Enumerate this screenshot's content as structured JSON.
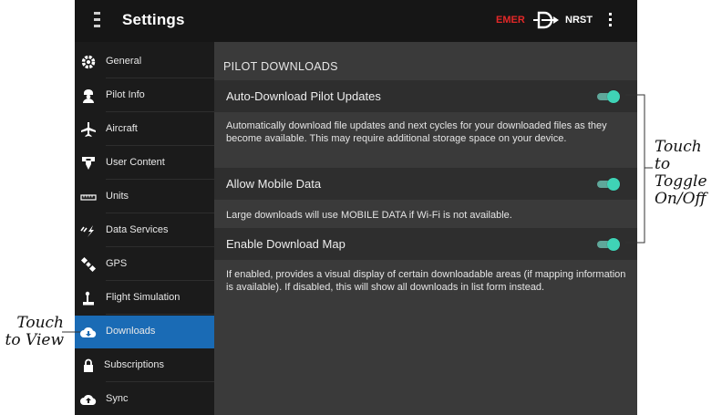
{
  "header": {
    "title": "Settings",
    "emer_label": "EMER",
    "nrst_label": "NRST",
    "menu_icon": "hamburger-menu-icon",
    "direct_to_icon": "direct-to-icon",
    "more_icon": "more-vert-icon"
  },
  "sidebar": {
    "items": [
      {
        "label": "General",
        "icon": "gear-icon"
      },
      {
        "label": "Pilot Info",
        "icon": "pilot-icon"
      },
      {
        "label": "Aircraft",
        "icon": "airplane-icon"
      },
      {
        "label": "User Content",
        "icon": "user-content-icon"
      },
      {
        "label": "Units",
        "icon": "ruler-icon"
      },
      {
        "label": "Data Services",
        "icon": "signal-icon"
      },
      {
        "label": "GPS",
        "icon": "satellite-icon"
      },
      {
        "label": "Flight Simulation",
        "icon": "joystick-icon"
      },
      {
        "label": "Downloads",
        "icon": "cloud-download-icon",
        "active": true
      },
      {
        "label": "Subscriptions",
        "icon": "lock-icon"
      },
      {
        "label": "Sync",
        "icon": "cloud-upload-icon"
      }
    ]
  },
  "main": {
    "section_title": "PILOT DOWNLOADS",
    "settings": [
      {
        "label": "Auto-Download Pilot Updates",
        "enabled": true,
        "description": "Automatically download file updates and next cycles for your downloaded files as they become available. This may require additional storage space on your device."
      },
      {
        "label": "Allow Mobile Data",
        "enabled": true,
        "description": "Large downloads will use MOBILE DATA if Wi-Fi is not available."
      },
      {
        "label": "Enable Download Map",
        "enabled": true,
        "description": "If enabled, provides a visual display of certain downloadable areas (if mapping information is available). If disabled, this will show all downloads in list form instead."
      }
    ]
  },
  "callouts": {
    "left_line1": "Touch",
    "left_line2": "to View",
    "right_line1": "Touch to",
    "right_line2": "Toggle",
    "right_line3": "On/Off"
  },
  "colors": {
    "accent": "#1a6bb5",
    "toggle_on": "#3fd3b6",
    "emer": "#e32828"
  }
}
